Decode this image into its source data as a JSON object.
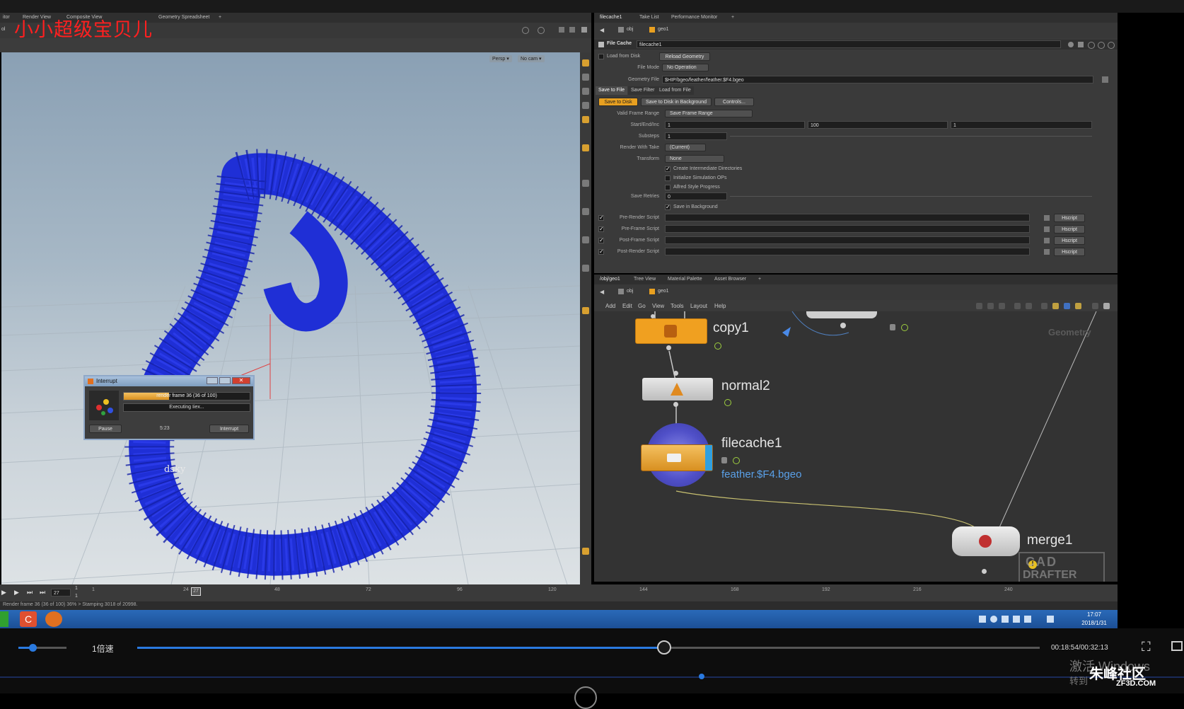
{
  "watermark_title": "小小超级宝贝儿",
  "viewport": {
    "tabs": [
      "itor",
      "Render View",
      "Composite View",
      "Geometry Spreadsheet"
    ],
    "path": "ol",
    "camera_persp": "Persp ▾",
    "camera_nocam": "No cam ▾",
    "overlay_text": "dsky"
  },
  "interrupt_dialog": {
    "title": "Interrupt",
    "progress_text": "render frame 36 (36 of 100)",
    "progress_percent": 36,
    "status": "Executing Iiex...",
    "pause_label": "Pause",
    "time": "5:23",
    "interrupt_label": "Interrupt"
  },
  "params": {
    "tabs": [
      "filecache1",
      "Take List",
      "Performance Monitor"
    ],
    "path_obj": "obj",
    "path_geo": "geo1",
    "node_type": "File Cache",
    "node_name": "filecache1",
    "load_from_disk": "Load from Disk",
    "reload_geometry": "Reload Geometry",
    "file_mode_label": "File Mode",
    "file_mode_value": "No Operation",
    "geometry_file_label": "Geometry File",
    "geometry_file_value": "$HIP/bgeo/feather/feather.$F4.bgeo",
    "subtabs": [
      "Save to File",
      "Save Filter",
      "Load from File"
    ],
    "save_to_disk": "Save to Disk",
    "save_bg": "Save to Disk in Background",
    "controls": "Controls...",
    "valid_frame_range_label": "Valid Frame Range",
    "valid_frame_range_value": "Save Frame Range",
    "start_end_inc_label": "Start/End/Inc",
    "start": "1",
    "end": "100",
    "inc": "1",
    "substeps_label": "Substeps",
    "substeps_value": "1",
    "render_with_take_label": "Render With Take",
    "render_with_take_value": "(Current)",
    "transform_label": "Transform",
    "transform_value": "None",
    "check_create_dirs": "Create Intermediate Directories",
    "check_init_sim": "Initialize Simulation OPs",
    "check_alfred": "Alfred Style Progress",
    "save_retries_label": "Save Retries",
    "save_retries_value": "0",
    "check_save_bg": "Save in Background",
    "scripts": [
      "Pre-Render Script",
      "Pre-Frame Script",
      "Post-Frame Script",
      "Post-Render Script"
    ],
    "hscript": "Hscript"
  },
  "network": {
    "tabs": [
      "/obj/geo1",
      "Tree View",
      "Material Palette",
      "Asset Browser"
    ],
    "path_obj": "obj",
    "path_geo": "geo1",
    "menu": [
      "Add",
      "Edit",
      "Go",
      "View",
      "Tools",
      "Layout",
      "Help"
    ],
    "context_label": "Geometry",
    "nodes": {
      "copy": "copy1",
      "normal": "normal2",
      "filecache": "filecache1",
      "filecache_file": "feather.$F4.bgeo",
      "merge": "merge1"
    },
    "watermark_logo_line1": "CAD",
    "watermark_logo_line2": "DRAFTER"
  },
  "timeline": {
    "current_frame": "27",
    "start_frame": "1",
    "end_frame": "1",
    "ticks": [
      "1",
      "24",
      "48",
      "72",
      "96",
      "120",
      "144",
      "168",
      "192",
      "216",
      "240"
    ],
    "status_text": "Render frame 36 (36 of 100) 36% > Stamping 3018 of 20998."
  },
  "taskbar": {
    "time": "17:07",
    "date": "2018/1/31"
  },
  "player": {
    "speed_label": "1倍速",
    "elapsed": "00:18:54",
    "total": "00:32:13",
    "time_display": "00:18:54/00:32:13",
    "progress_fraction": 0.585,
    "volume_fraction": 0.3,
    "activate_windows": "激活 Windows",
    "activate_sub": "转到",
    "site_logo": "朱峰社区",
    "site_url": "ZF3D.COM"
  },
  "colors": {
    "feather_blue": "#1f2fd6",
    "selected_tab": "#e8a020",
    "node_orange": "#f0a020",
    "title_red": "#ff2020"
  }
}
